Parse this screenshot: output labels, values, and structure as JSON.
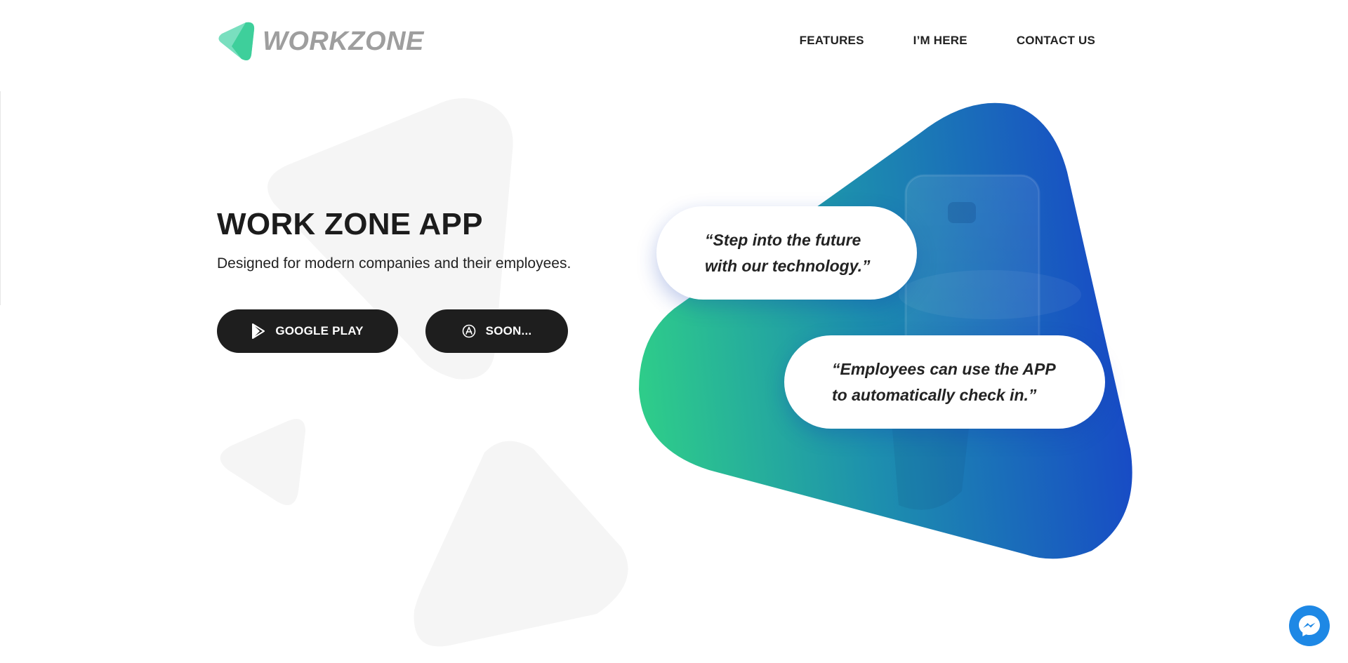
{
  "brand": {
    "name": "WORKZONE",
    "logo_icon": "triangle-logo-icon",
    "colors": {
      "logo_green": "#3ecf9b",
      "logo_text": "#9e9e9e"
    }
  },
  "nav": {
    "items": [
      {
        "label": "FEATURES"
      },
      {
        "label": "I’M HERE"
      },
      {
        "label": "CONTACT US"
      }
    ]
  },
  "hero": {
    "title": "WORK ZONE APP",
    "subtitle": "Designed for modern companies and their employees.",
    "buttons": [
      {
        "label": "GOOGLE PLAY",
        "icon": "play-store-icon"
      },
      {
        "label": "SOON...",
        "icon": "app-store-icon"
      }
    ]
  },
  "quotes": [
    {
      "line1": "“Step into the future",
      "line2": "with our technology.”"
    },
    {
      "line1": "“Employees can use the APP",
      "line2": "to automatically check in.”"
    }
  ],
  "colors": {
    "gradient_start": "#2ecc8a",
    "gradient_mid": "#1a8fb0",
    "gradient_end": "#1747c7",
    "button_bg": "#1e1e1e",
    "bg_shape": "#f5f5f5",
    "messenger": "#1e88e5"
  },
  "widgets": {
    "chat_icon": "messenger-icon"
  }
}
